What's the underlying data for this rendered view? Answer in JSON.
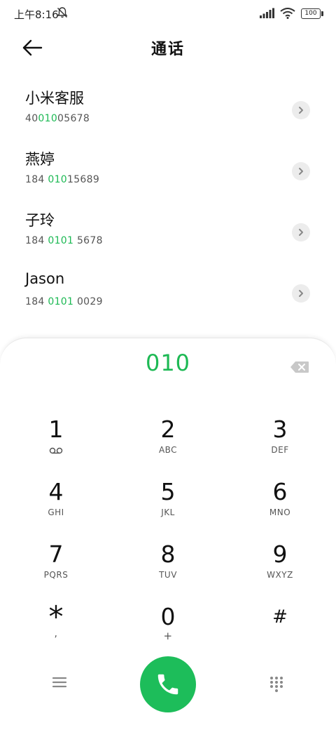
{
  "status_bar": {
    "time": "上午8:16",
    "battery": "100"
  },
  "header": {
    "title": "通话"
  },
  "contacts": [
    {
      "name": "小米客服",
      "number_pre": "40",
      "number_match": "010",
      "number_post": "05678"
    },
    {
      "name": "燕婷",
      "number_pre": "184 ",
      "number_match": "010",
      "number_post": "15689"
    },
    {
      "name": "子玲",
      "number_pre": "184 ",
      "number_match": "0101",
      "number_post": " 5678"
    },
    {
      "name": "Jason",
      "number_pre": "184 ",
      "number_match": "0101",
      "number_post": " 0029"
    }
  ],
  "dialer": {
    "display": "010",
    "keys": [
      {
        "digit": "1",
        "letters": ""
      },
      {
        "digit": "2",
        "letters": "ABC"
      },
      {
        "digit": "3",
        "letters": "DEF"
      },
      {
        "digit": "4",
        "letters": "GHI"
      },
      {
        "digit": "5",
        "letters": "JKL"
      },
      {
        "digit": "6",
        "letters": "MNO"
      },
      {
        "digit": "7",
        "letters": "PQRS"
      },
      {
        "digit": "8",
        "letters": "TUV"
      },
      {
        "digit": "9",
        "letters": "WXYZ"
      },
      {
        "digit": "*",
        "letters": ","
      },
      {
        "digit": "0",
        "letters": "+"
      },
      {
        "digit": "#",
        "letters": ""
      }
    ]
  },
  "colors": {
    "accent": "#1db954",
    "call_button": "#1dbd5a"
  }
}
